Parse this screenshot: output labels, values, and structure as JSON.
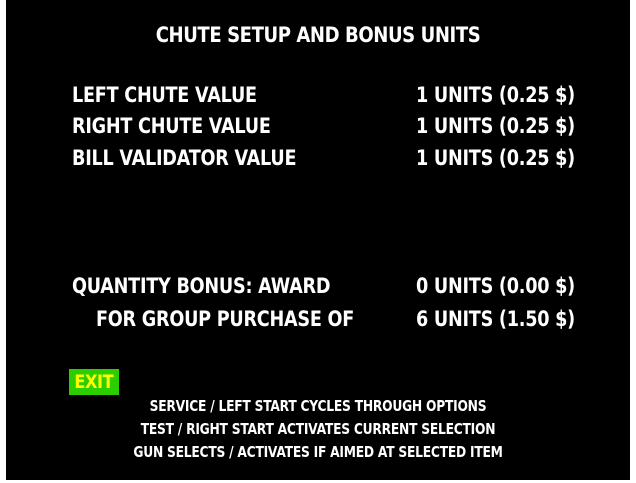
{
  "screen": {
    "title": "CHUTE SETUP AND BONUS UNITS",
    "settings": [
      {
        "label": "LEFT CHUTE VALUE",
        "value": "1 UNITS (0.25 $)"
      },
      {
        "label": "RIGHT CHUTE VALUE",
        "value": "1 UNITS (0.25 $)"
      },
      {
        "label": "BILL VALIDATOR VALUE",
        "value": "1 UNITS (0.25 $)"
      }
    ],
    "bonus": [
      {
        "label": "QUANTITY BONUS: AWARD",
        "value": "0 UNITS (0.00 $)"
      },
      {
        "label": "FOR GROUP PURCHASE OF",
        "value": "6 UNITS (1.50 $)"
      }
    ],
    "exit_label": "EXIT",
    "help_lines": [
      "SERVICE / LEFT START CYCLES THROUGH OPTIONS",
      "TEST / RIGHT START ACTIVATES CURRENT SELECTION",
      "GUN SELECTS / ACTIVATES IF AIMED AT SELECTED ITEM"
    ],
    "colors": {
      "background": "#000000",
      "text": "#ffffff",
      "selected_bg": "#2bcf00",
      "selected_text": "#ffff00"
    }
  }
}
